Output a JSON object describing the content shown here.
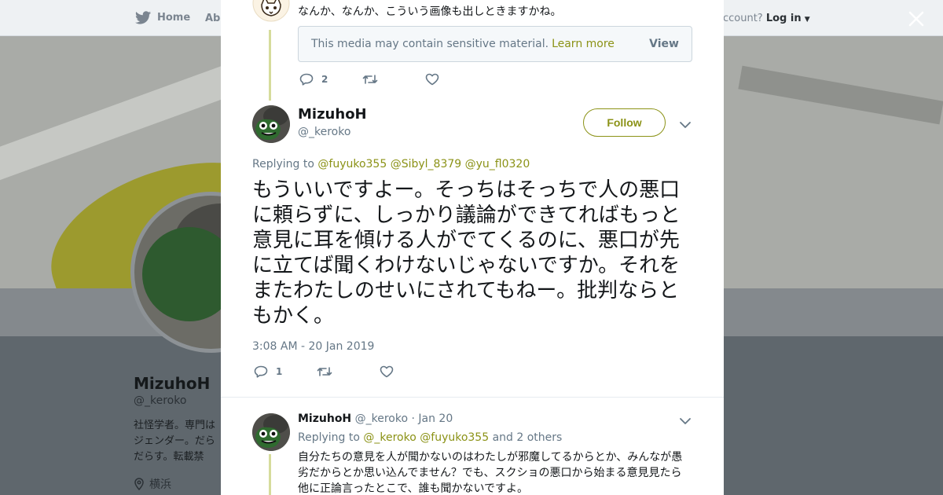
{
  "nav": {
    "home_label": "Home",
    "about_label": "Abo",
    "account_prompt": "account?",
    "login_label": "Log in"
  },
  "profile": {
    "name": "MizuhoH",
    "handle": "@_keroko",
    "bio": "社怪学者。専門はジェンダー。だらだらす。転載禁止。",
    "location": "横浜"
  },
  "previous_tweet": {
    "text": "なんか、なんか、こういう画像も出しときますかね。",
    "sensitive_notice": "This media may contain sensitive material.",
    "learn_more_label": "Learn more",
    "view_label": "View",
    "reply_count": "2",
    "retweet_count": "",
    "like_count": ""
  },
  "main_tweet": {
    "name": "MizuhoH",
    "handle": "@_keroko",
    "follow_label": "Follow",
    "replying_to_label": "Replying to",
    "replying_to": [
      "@fuyuko355",
      "@Sibyl_8379",
      "@yu_fl0320"
    ],
    "text": "もういいですよー。そっちはそっちで人の悪口に頼らずに、しっかり議論ができてればもっと意見に耳を傾ける人がでてくるのに、悪口が先に立てば聞くわけないじゃないですか。それをまたわたしのせいにされてもねー。批判ならともかく。",
    "timestamp": "3:08 AM - 20 Jan 2019",
    "reply_count": "1",
    "retweet_count": "",
    "like_count": ""
  },
  "reply_tweet": {
    "name": "MizuhoH",
    "handle": "@_keroko",
    "date": "· Jan 20",
    "replying_to_label": "Replying to",
    "mention_1": "@_keroko",
    "mention_2": "@fuyuko355",
    "others": "and 2 others",
    "text": "自分たちの意見を人が聞かないのはわたしが邪魔してるからとか、みんなが愚劣だからとか思い込んでません？でも、スクショの悪口から始まる意見見たら他に正論言ったとこで、誰も聞かないですよ。"
  },
  "colors": {
    "accent": "#8b9216",
    "text_primary": "#14171a",
    "text_secondary": "#657786",
    "overlay": "#596166",
    "thread_line": "#d6dc9c"
  },
  "icons": {
    "reply": "reply-icon",
    "retweet": "retweet-icon",
    "like": "heart-icon",
    "close": "close-icon",
    "caret": "chevron-down-icon",
    "bird": "twitter-bird-icon",
    "location": "location-pin-icon"
  }
}
